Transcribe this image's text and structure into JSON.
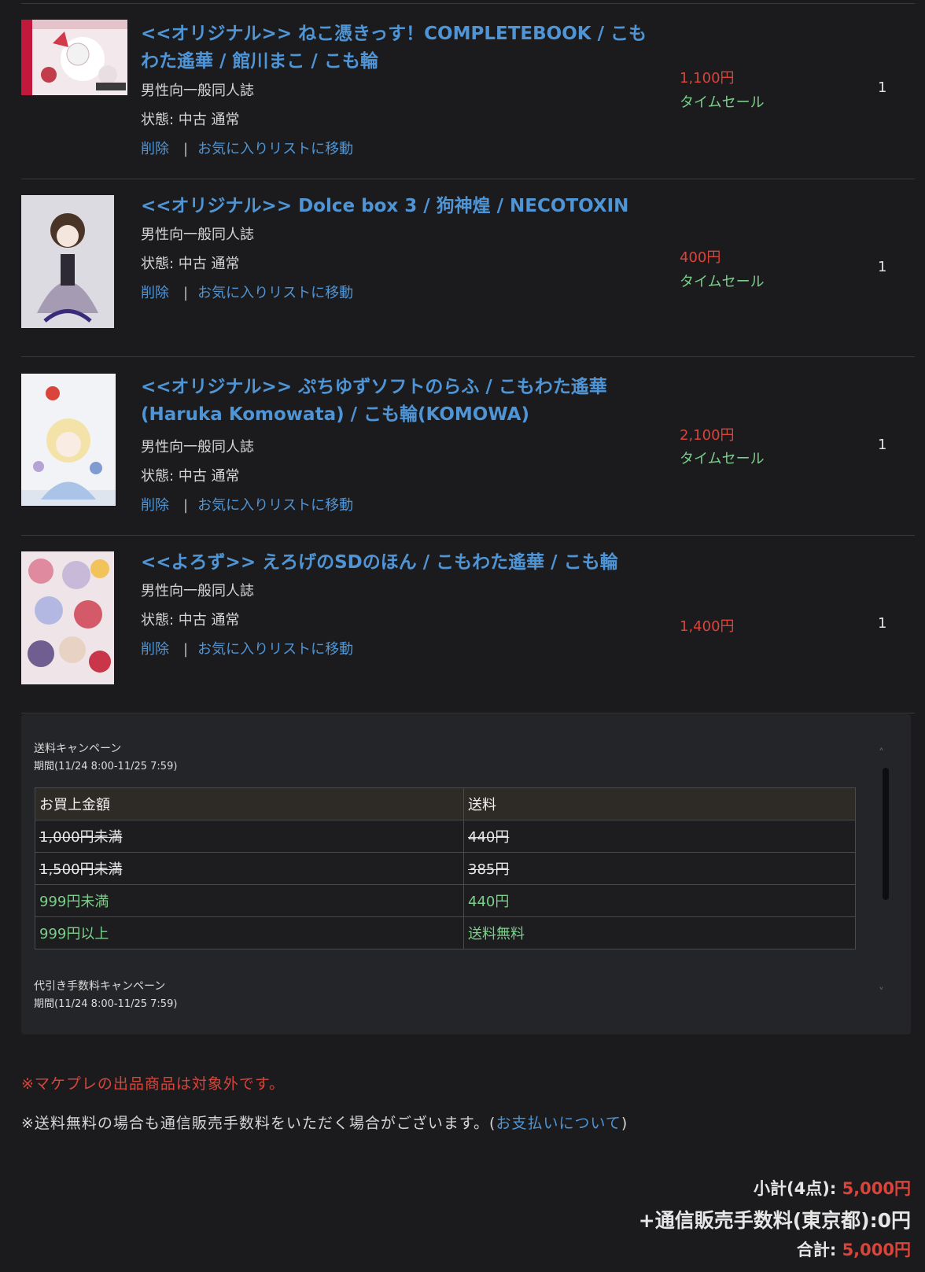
{
  "items": [
    {
      "title": "<<オリジナル>> ねこ憑きっす！COMPLETEBOOK / こもわた遙華 / 館川まこ / こも輪",
      "title_line1": "<<オリジナル>> ねこ憑きっす！COMPLETEBOOK / こも",
      "title_line2": "わた遙華 / 館川まこ / こも輪",
      "category": "男性向一般同人誌",
      "condition": "状態: 中古 通常",
      "delete_label": "削除",
      "favorite_label": "お気に入りリストに移動",
      "price": "1,100円",
      "sale": "タイムセール",
      "qty": "1"
    },
    {
      "title": "<<オリジナル>> Dolce box 3 / 狗神煌 / NECOTOXIN",
      "category": "男性向一般同人誌",
      "condition": "状態: 中古 通常",
      "delete_label": "削除",
      "favorite_label": "お気に入りリストに移動",
      "price": "400円",
      "sale": "タイムセール",
      "qty": "1"
    },
    {
      "title": "<<オリジナル>> ぷちゆずソフトのらふ / こもわた遙華 (Haruka Komowata) / こも輪(KOMOWA)",
      "title_line1": "<<オリジナル>> ぷちゆずソフトのらふ / こもわた遙華",
      "title_line2": "(Haruka Komowata) / こも輪(KOMOWA)",
      "category": "男性向一般同人誌",
      "condition": "状態: 中古 通常",
      "delete_label": "削除",
      "favorite_label": "お気に入りリストに移動",
      "price": "2,100円",
      "sale": "タイムセール",
      "qty": "1"
    },
    {
      "title": "<<よろず>> えろげのSDのほん / こもわた遙華 / こも輪",
      "category": "男性向一般同人誌",
      "condition": "状態: 中古 通常",
      "delete_label": "削除",
      "favorite_label": "お気に入りリストに移動",
      "price": "1,400円",
      "qty": "1"
    }
  ],
  "campaign": {
    "shipping_title": "送料キャンペーン",
    "shipping_period": "期間(11/24 8:00-11/25 7:59)",
    "table_headers": [
      "お買上金額",
      "送料"
    ],
    "rows": [
      {
        "amount": "1,000円未満",
        "fee": "440円",
        "struck": true
      },
      {
        "amount": "1,500円未満",
        "fee": "385円",
        "struck": true
      },
      {
        "amount": "999円未満",
        "fee": "440円",
        "struck": false
      },
      {
        "amount": "999円以上",
        "fee": "送料無料",
        "struck": false
      }
    ],
    "cod_title": "代引き手数料キャンペーン",
    "cod_period": "期間(11/24 8:00-11/25 7:59)"
  },
  "notes": {
    "marketplace": "※マケプレの出品商品は対象外です。",
    "free_shipping_prefix": "※送料無料の場合も通信販売手数料をいただく場合がございます。(",
    "payment_link": "お支払いについて",
    "free_shipping_suffix": ")"
  },
  "totals": {
    "subtotal_label": "小計(4点):",
    "subtotal_value": "5,000円",
    "fee_label": "+通信販売手数料(東京都):0円",
    "total_label": "合計:",
    "total_value": "5,000円"
  },
  "colors": {
    "link": "#4f95d6",
    "price": "#d9443b",
    "sale": "#7bcf8a",
    "background": "#1b1b1d"
  }
}
